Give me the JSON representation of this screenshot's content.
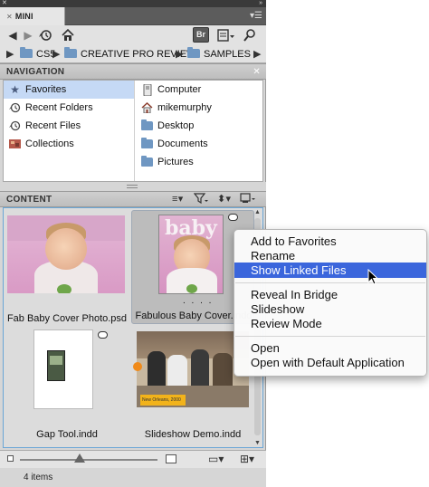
{
  "panel": {
    "tab_title": "MINI BRIDGE",
    "br_badge": "Br"
  },
  "breadcrumb": [
    "CS5",
    "CREATIVE PRO REVIEW",
    "SAMPLES"
  ],
  "navigation": {
    "title": "NAVIGATION",
    "left": [
      {
        "label": "Favorites",
        "icon": "star-icon",
        "selected": true
      },
      {
        "label": "Recent Folders",
        "icon": "recent-folders-icon"
      },
      {
        "label": "Recent Files",
        "icon": "recent-files-icon"
      },
      {
        "label": "Collections",
        "icon": "collections-icon"
      }
    ],
    "right": [
      {
        "label": "Computer",
        "icon": "computer-icon"
      },
      {
        "label": "mikemurphy",
        "icon": "home-icon"
      },
      {
        "label": "Desktop",
        "icon": "folder-icon"
      },
      {
        "label": "Documents",
        "icon": "folder-icon"
      },
      {
        "label": "Pictures",
        "icon": "folder-icon"
      }
    ]
  },
  "content": {
    "title": "CONTENT",
    "items": [
      {
        "name": "Fab Baby Cover Photo.psd"
      },
      {
        "name": "Fabulous Baby Cover.indd",
        "selected": true,
        "dots": ". . . ."
      },
      {
        "name": "Gap Tool.indd"
      },
      {
        "name": "Slideshow Demo.indd",
        "sticker": "New Orleans, 2000"
      }
    ],
    "status": "4 items"
  },
  "context_menu": {
    "groups": [
      [
        "Add to Favorites",
        "Rename",
        "Show Linked Files"
      ],
      [
        "Reveal In Bridge",
        "Slideshow",
        "Review Mode"
      ],
      [
        "Open",
        "Open with Default Application"
      ]
    ],
    "highlighted": "Show Linked Files"
  },
  "colors": {
    "selection": "#c5d9f5",
    "menu_highlight": "#3b66dc",
    "folder": "#6f97c2"
  }
}
